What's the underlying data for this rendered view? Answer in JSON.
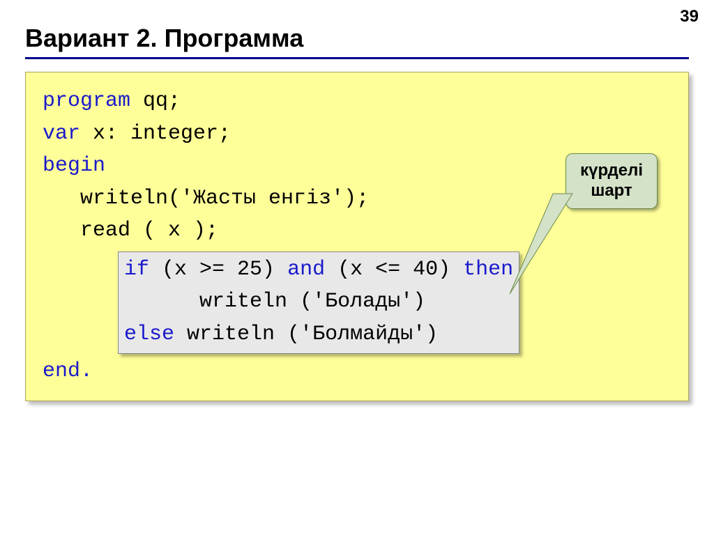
{
  "page_number": "39",
  "title": "Вариант 2. Программа",
  "code": {
    "line1_kw": "program",
    "line1_rest": " qq;",
    "line2_kw": "var",
    "line2_rest": " x: integer;",
    "line3_kw": "begin",
    "line4": "   writeln('Жасты енгіз');",
    "line5": "   read ( x );",
    "inner1a": "if",
    "inner1b": " (x >= 25) ",
    "inner1c": "and",
    "inner1d": " (x <= 40) ",
    "inner1e": "then",
    "inner2": "      writeln ('Болады')",
    "inner3a": "else",
    "inner3b": " writeln ('Болмайды')",
    "line6_kw": "end."
  },
  "callout": {
    "line1": "күрделі",
    "line2": "шарт"
  }
}
